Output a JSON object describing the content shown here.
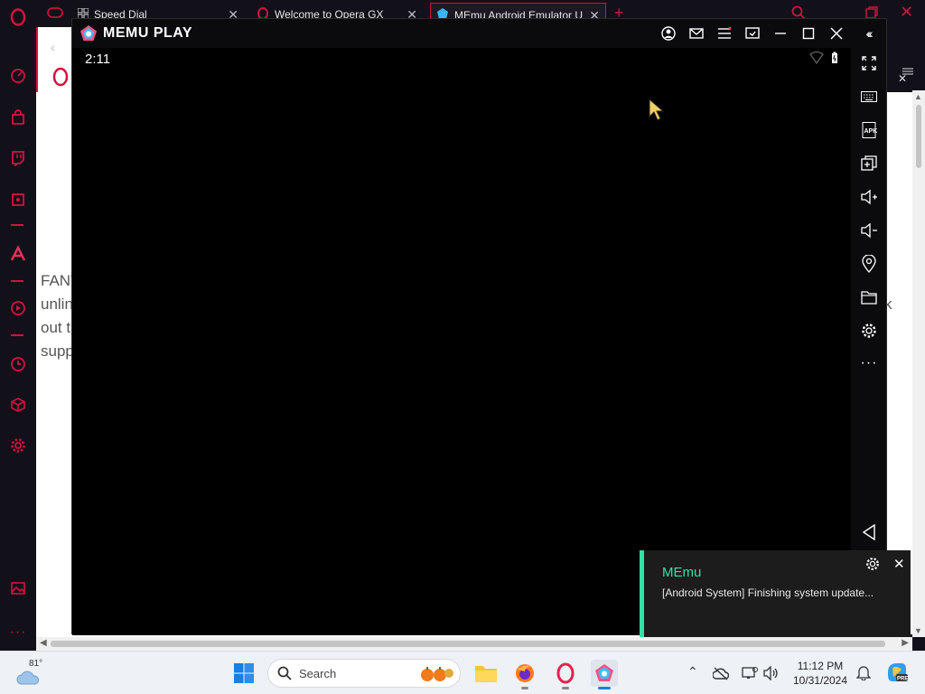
{
  "browser": {
    "tabs": [
      {
        "label": "Speed Dial",
        "icon": "grid-icon"
      },
      {
        "label": "Welcome to Opera GX",
        "icon": "opera-icon"
      },
      {
        "label": "MEmu Android Emulator U",
        "icon": "memu-icon",
        "active": true
      }
    ],
    "accent": "#d3123f"
  },
  "web_page": {
    "text_lines": [
      "FANT",
      "unlin",
      "out t",
      "supp"
    ],
    "right_fragment": "k"
  },
  "memu": {
    "app_name": "MEMU PLAY",
    "clock": "2:11",
    "titlebar_buttons": [
      "user-icon",
      "mail-icon",
      "menu-icon",
      "screen-icon",
      "minimize-icon",
      "maximize-icon",
      "close-icon",
      "collapse-icon"
    ],
    "side_tools": [
      "fullscreen-icon",
      "keyboard-icon",
      "apk-icon",
      "multi-window-icon",
      "volume-up-icon",
      "volume-down-icon",
      "location-icon",
      "folder-icon",
      "settings-icon",
      "more-icon",
      "back-icon"
    ]
  },
  "notification": {
    "title": "MEmu",
    "message": "[Android System] Finishing system update...",
    "accent": "#33e0a8"
  },
  "taskbar": {
    "weather_temp": "81°",
    "search_placeholder": "Search",
    "time": "11:12 PM",
    "date": "10/31/2024"
  }
}
